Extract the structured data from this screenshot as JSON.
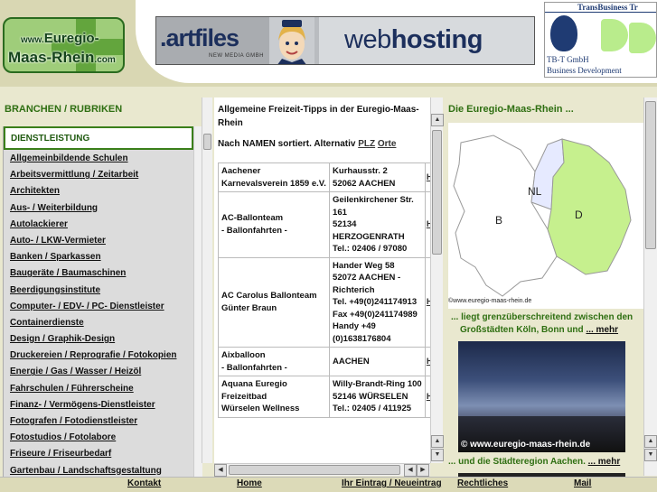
{
  "header": {
    "logo": {
      "line1_small": "www.",
      "line1": "Euregio-",
      "line2": "Maas-Rhein",
      "line2_small": ".com"
    },
    "banner": {
      "brand_dot": ".",
      "brand": "artfiles",
      "subtitle": "NEW MEDIA GMBH",
      "web": "web",
      "hosting": "hosting"
    },
    "tbt": {
      "top": "TransBusiness Tr",
      "line1": "TB-T GmbH",
      "line2": "Business Development"
    }
  },
  "left": {
    "title": "BRANCHEN / RUBRIKEN",
    "heading": "DIENSTLEISTUNG",
    "items": [
      "Allgemeinbildende Schulen",
      "Arbeitsvermittlung / Zeitarbeit",
      "Architekten",
      "Aus- / Weiterbildung",
      "Autolackierer",
      "Auto- / LKW-Vermieter",
      "Banken / Sparkassen",
      "Baugeräte / Baumaschinen",
      "Beerdigungsinstitute",
      "Computer- / EDV- / PC- Dienstleister",
      "Containerdienste",
      "Design / Graphik-Design",
      "Druckereien / Reprografie / Fotokopien",
      "Energie / Gas / Wasser / Heizöl",
      "Fahrschulen / Führerscheine",
      "Finanz- / Vermögens-Dienstleister",
      "Fotografen / Fotodienstleister",
      "Fotostudios / Fotolabore",
      "Friseure / Friseurbedarf",
      "Gartenbau / Landschaftsgestaltung"
    ]
  },
  "middle": {
    "title": "Allgemeine Freizeit-Tipps in der Euregio-Maas-Rhein",
    "sort_prefix": "Nach NAMEN sortiert. Alternativ",
    "sort_plz": "PLZ",
    "sort_orte": "Orte",
    "rows": [
      {
        "name": "Aachener Karnevalsverein 1859 e.V.",
        "addr": "Kurhausstr. 2\n52062 AACHEN",
        "h": "H"
      },
      {
        "name": "AC-Ballonteam\n- Ballonfahrten -",
        "addr": "Geilenkirchener Str. 161\n52134 HERZOGENRATH\nTel.: 02406 / 97080",
        "h": "H"
      },
      {
        "name": "AC Carolus Ballonteam Günter Braun",
        "addr": "Hander Weg 58\n52072 AACHEN - Richterich\nTel. +49(0)241174913\nFax +49(0)241174989\nHandy +49 (0)1638176804",
        "h": "H"
      },
      {
        "name": "Aixballoon\n- Ballonfahrten -",
        "addr": "AACHEN",
        "h": "H"
      },
      {
        "name": "Aquana Euregio Freizeitbad\nWürselen Wellness",
        "addr": "Willy-Brandt-Ring 100\n52146 WÜRSELEN\nTel.: 02405 / 411925",
        "h": "H"
      }
    ]
  },
  "right": {
    "title": "Die Euregio-Maas-Rhein ...",
    "map_labels": {
      "nl": "NL",
      "b": "B",
      "d": "D"
    },
    "map_copy": "©www.euregio-maas-rhein.de",
    "text1": "... liegt grenzüberschreitend zwischen den",
    "text2": "Großstädten Köln, Bonn und",
    "mehr": "... mehr",
    "photo_caption": "© www.euregio-maas-rhein.de",
    "text3": "... und die Städteregion Aachen.",
    "mehr2": "... mehr"
  },
  "footer": {
    "kontakt": "Kontakt",
    "home": "Home",
    "eintrag": "Ihr Eintrag / Neueintrag",
    "rechtliches": "Rechtliches",
    "mail": "Mail"
  },
  "colors": {
    "green_text": "#2f6f12",
    "page_bg": "#e9e8cf",
    "map_nl": "#e6eaff",
    "map_d": "#c6f08e",
    "map_b": "#ffffff"
  }
}
